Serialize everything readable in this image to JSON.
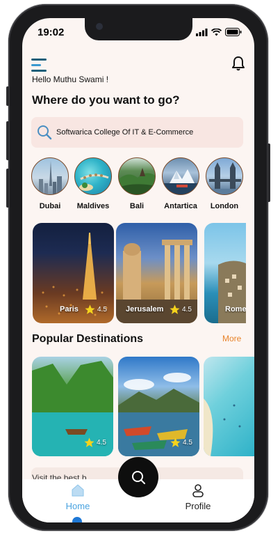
{
  "status_bar": {
    "time": "19:02"
  },
  "header": {
    "greeting": "Hello Muthu Swami !",
    "headline": "Where do you want to go?"
  },
  "search": {
    "value": "Softwarica College Of IT & E-Commerce"
  },
  "cities": [
    {
      "name": "Dubai"
    },
    {
      "name": "Maldives"
    },
    {
      "name": "Bali"
    },
    {
      "name": "Antartica"
    },
    {
      "name": "London"
    }
  ],
  "featured_cards": [
    {
      "name": "Paris",
      "rating": "4.5"
    },
    {
      "name": "Jerusalem",
      "rating": "4.5"
    },
    {
      "name": "Rome",
      "rating": ""
    }
  ],
  "popular": {
    "title": "Popular Destinations",
    "more_label": "More",
    "cards": [
      {
        "rating": "4.5"
      },
      {
        "rating": "4.5"
      },
      {
        "rating": ""
      }
    ]
  },
  "promo": {
    "text": "Visit the best b"
  },
  "tabbar": {
    "home_label": "Home",
    "profile_label": "Profile"
  },
  "colors": {
    "accent_orange": "#e8832a",
    "active_blue": "#4aa3e0",
    "background": "#fcf5f2",
    "search_bg": "#f8e6e2"
  },
  "icons": [
    "menu-icon",
    "bell-icon",
    "search-icon",
    "star-icon",
    "home-icon",
    "profile-icon",
    "signal-icon",
    "wifi-icon",
    "battery-icon"
  ]
}
